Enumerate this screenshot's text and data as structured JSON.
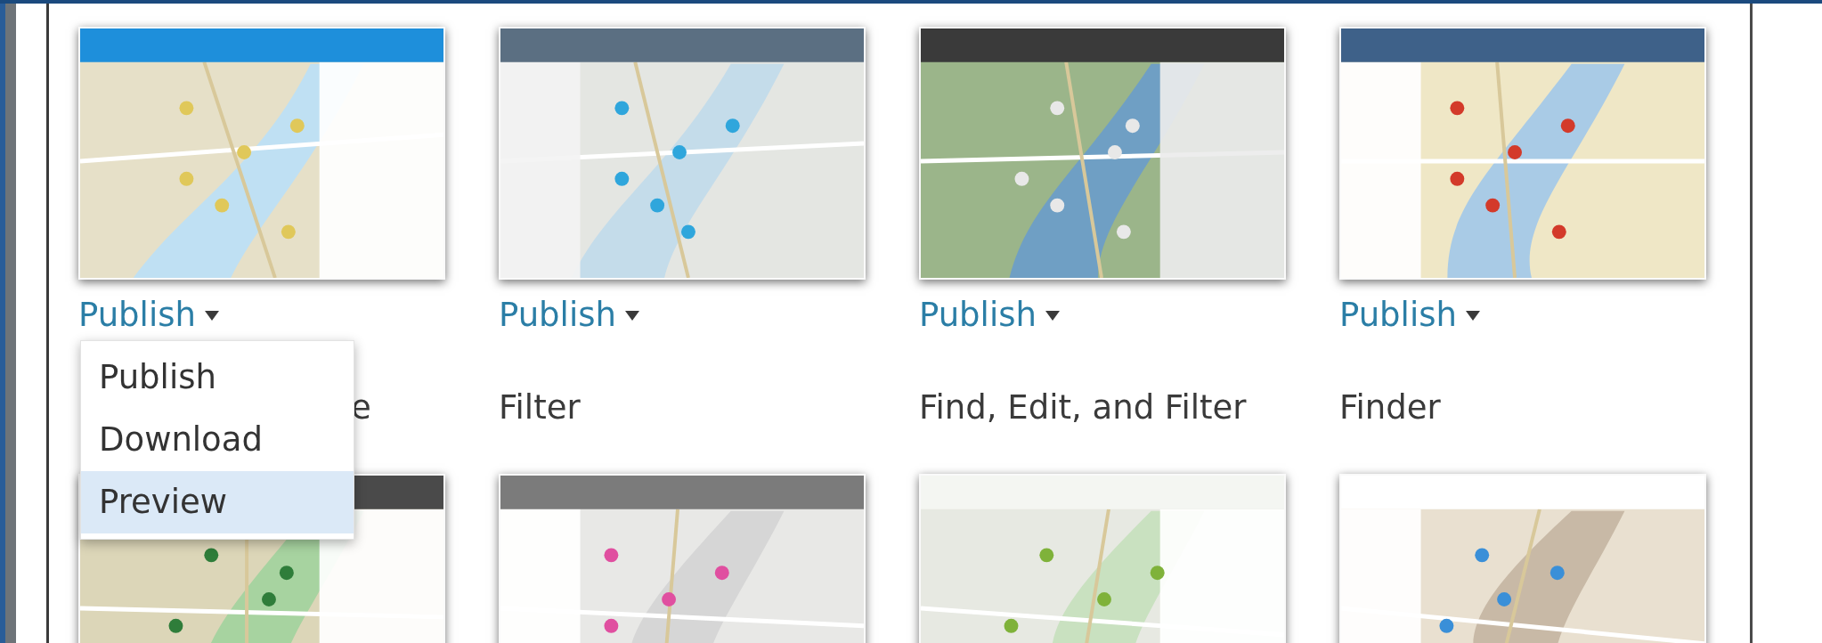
{
  "apps": [
    {
      "thumbnail": {
        "kind": "picture"
      },
      "publish": "Publish",
      "title": "e",
      "covered": true,
      "menu": {
        "items": [
          {
            "label": "Publish",
            "selected": false
          },
          {
            "label": "Download",
            "selected": false
          },
          {
            "label": "Preview",
            "selected": true
          }
        ]
      }
    },
    {
      "thumbnail": {
        "kind": "picture"
      },
      "publish": "Publish",
      "title": "Filter"
    },
    {
      "thumbnail": {
        "kind": "picture"
      },
      "publish": "Publish",
      "title": "Find, Edit, and Filter"
    },
    {
      "thumbnail": {
        "kind": "picture"
      },
      "publish": "Publish",
      "title": "Finder"
    },
    {
      "thumbnail": {
        "kind": "picture"
      }
    },
    {
      "thumbnail": {
        "kind": "picture"
      }
    },
    {
      "thumbnail": {
        "kind": "picture"
      }
    },
    {
      "thumbnail": {
        "kind": "picture"
      }
    }
  ]
}
